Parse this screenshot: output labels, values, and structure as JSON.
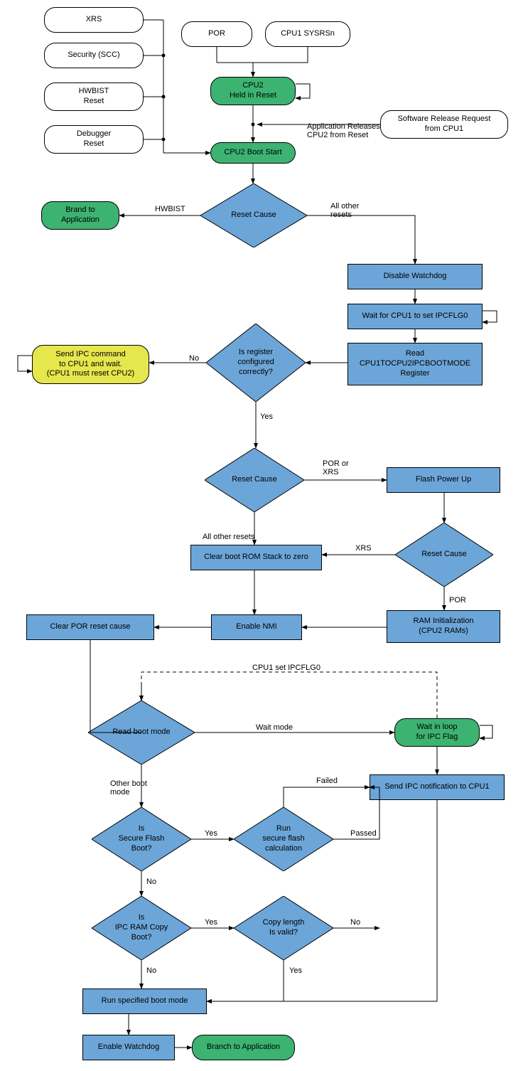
{
  "nodes": {
    "xrs": "XRS",
    "security": "Security (SCC)",
    "hwbist_reset": "HWBIST\nReset",
    "debugger_reset": "Debugger\nReset",
    "por": "POR",
    "cpu1_sysrsn": "CPU1 SYSRSn",
    "cpu2_held": "CPU2\nHeld in Reset",
    "sw_release": "Software Release Request\nfrom CPU1",
    "cpu2_boot_start": "CPU2 Boot Start",
    "brand_to_app": "Brand to\nApplication",
    "reset_cause_1": "Reset Cause",
    "disable_wd": "Disable Watchdog",
    "wait_ipcflg0": "Wait for CPU1 to set IPCFLG0",
    "read_ipc": "Read\nCPU1TOCPU2IPCBOOTMODE\nRegister",
    "reg_correct": "Is register\nconfigured\ncorrectly?",
    "send_ipc_wait": "Send IPC command\nto CPU1 and wait.\n(CPU1 must reset CPU2)",
    "reset_cause_2": "Reset Cause",
    "flash_pu": "Flash Power Up",
    "clear_stack": "Clear boot ROM Stack to zero",
    "reset_cause_3": "Reset Cause",
    "enable_nmi": "Enable NMI",
    "ram_init": "RAM Initialization\n(CPU2 RAMs)",
    "clear_por": "Clear POR reset cause",
    "read_boot_mode": "Read boot mode",
    "wait_in_loop": "Wait in loop\nfor IPC Flag",
    "send_ipc_notif": "Send IPC notification to CPU1",
    "secure_flash": "Is\nSecure Flash\nBoot?",
    "run_sfc": "Run\nsecure flash\ncalculation",
    "ipc_ram": "Is\nIPC RAM Copy\nBoot?",
    "copy_len": "Copy length\nIs valid?",
    "run_boot": "Run specified boot mode",
    "enable_wd": "Enable Watchdog",
    "branch_app": "Branch to Application"
  },
  "labels": {
    "app_releases": "Application Releases\nCPU2 from Reset",
    "hwbist": "HWBIST",
    "all_other_resets_1": "All other\nresets",
    "no1": "No",
    "yes1": "Yes",
    "por_or_xrs": "POR or\nXRS",
    "all_other_resets_2": "All other resets",
    "xrs": "XRS",
    "por": "POR",
    "cpu1_set_ipc": "CPU1 set IPCFLG0",
    "wait_mode": "Wait mode",
    "other_boot": "Other boot\nmode",
    "yes_sf": "Yes",
    "no_sf": "No",
    "failed": "Failed",
    "passed": "Passed",
    "yes_ipc": "Yes",
    "no_ipc": "No",
    "no_copy": "No",
    "yes_copy": "Yes"
  }
}
